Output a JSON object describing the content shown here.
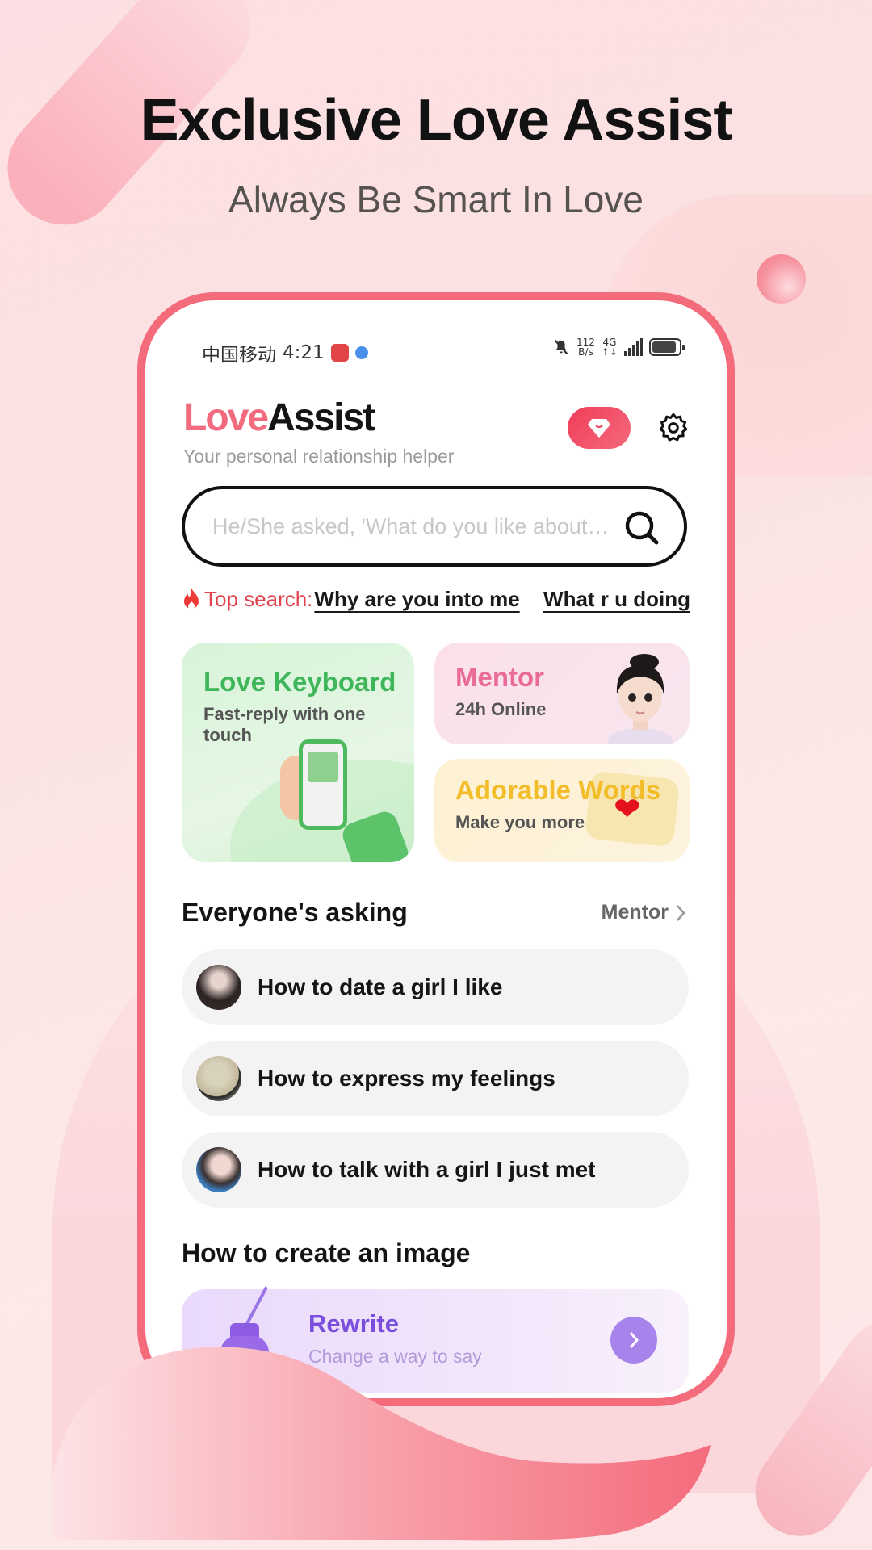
{
  "promo": {
    "headline": "Exclusive Love Assist",
    "subheadline": "Always Be Smart In Love"
  },
  "status_bar": {
    "carrier": "中国移动",
    "time": "4:21",
    "net_speed_value": "112",
    "net_speed_unit": "B/s",
    "network_type": "4G",
    "icons": [
      "huawei-app-icon",
      "browser-icon",
      "mute-bell-icon",
      "signal-icon",
      "battery-icon"
    ]
  },
  "header": {
    "brand_love": "Love",
    "brand_assist": "Assist",
    "tagline": "Your personal relationship helper",
    "vip_icon": "diamond-icon",
    "settings_icon": "gear-icon"
  },
  "search": {
    "placeholder": "He/She asked, 'What do you like about…",
    "value": ""
  },
  "top_search": {
    "label": "Top search:",
    "links": [
      "Why are you into me",
      "What r u doing"
    ]
  },
  "feature_cards": {
    "keyboard": {
      "title": "Love Keyboard",
      "desc": "Fast-reply with one touch"
    },
    "mentor": {
      "title": "Mentor",
      "desc": "24h Online"
    },
    "words": {
      "title": "Adorable Words",
      "desc": "Make you more"
    }
  },
  "everyone_asking": {
    "title": "Everyone's asking",
    "more_label": "Mentor",
    "items": [
      {
        "text": "How to date a girl I like"
      },
      {
        "text": "How to express my feelings"
      },
      {
        "text": "How to talk with a girl I just met"
      }
    ]
  },
  "create_image": {
    "title": "How to create an image",
    "card": {
      "title": "Rewrite",
      "desc": "Change a way to say"
    }
  },
  "colors": {
    "brand_pink": "#f26b7e",
    "frame": "#f46b7c",
    "keyboard_green": "#3fb65a",
    "mentor_pink": "#e86b98",
    "words_yellow": "#f3bd2a",
    "rewrite_purple": "#7b4fde"
  }
}
